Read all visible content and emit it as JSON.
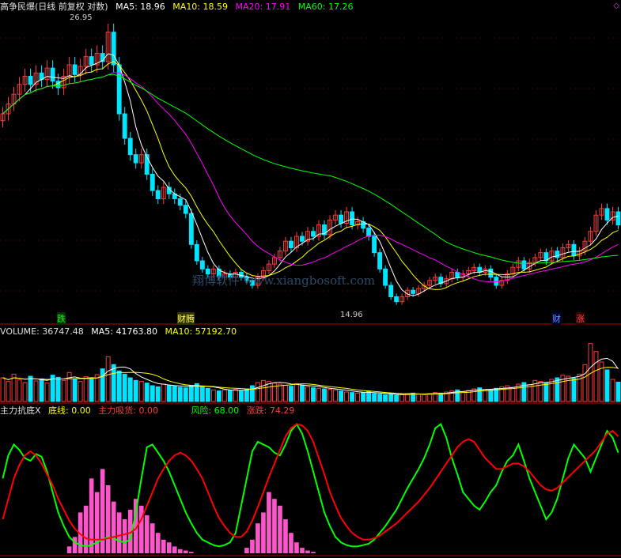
{
  "header_main": {
    "title": "高争民爆(日线 前复权 对数)",
    "ma5": "MA5: 18.96",
    "ma10": "MA10: 18.59",
    "ma20": "MA20: 17.91",
    "ma60": "MA60: 17.26"
  },
  "header_volume": {
    "volume": "VOLUME: 36747.48",
    "ma5": "MA5: 41763.80",
    "ma10": "MA10: 57192.70"
  },
  "header_indicator": {
    "name": "主力抗底X",
    "bottom_line": "底线: 0.00",
    "main_buy": "主力吸货: 0.00",
    "risk": "风险: 68.00",
    "rise_fall": "涨跌: 74.29"
  },
  "annotations": {
    "high_price": "26.95",
    "low_price": "14.96",
    "tag_die": "跌",
    "tag_yuan": "财腾",
    "tag_cai": "财",
    "tag_zhang": "涨",
    "corner": "◇"
  },
  "watermark": "翔博软件 www.xiangbosoft.com",
  "colors": {
    "up": "#ff3a3a",
    "down": "#00e5ff",
    "ma5": "#ffffff",
    "ma10": "#ffff00",
    "ma20": "#ff00ff",
    "ma60": "#00ff00",
    "risk": "#00ff00",
    "rise": "#ff0000",
    "bars": "#ff55cc",
    "axis": "#b00000"
  },
  "chart_data": {
    "type": "candlestick",
    "closes": [
      21.0,
      21.6,
      22.2,
      22.8,
      23.3,
      22.8,
      23.5,
      23.1,
      23.8,
      23.0,
      22.6,
      23.3,
      24.0,
      23.4,
      23.9,
      24.5,
      24.0,
      24.7,
      24.2,
      26.0,
      24.0,
      21.0,
      19.5,
      18.5,
      18.0,
      18.5,
      17.3,
      16.3,
      15.8,
      16.5,
      16.1,
      15.8,
      15.4,
      14.9,
      13.0,
      12.0,
      11.5,
      11.2,
      11.5,
      11.0,
      11.2,
      11.0,
      11.3,
      11.0,
      10.8,
      10.5,
      11.0,
      11.4,
      11.8,
      12.2,
      12.6,
      13.2,
      12.8,
      13.5,
      13.2,
      13.8,
      13.5,
      14.2,
      13.6,
      14.5,
      14.8,
      14.3,
      15.0,
      14.2,
      14.4,
      14.0,
      13.5,
      12.5,
      11.5,
      10.5,
      9.8,
      9.5,
      9.8,
      10.2,
      10.0,
      10.3,
      10.5,
      10.8,
      11.0,
      10.6,
      10.9,
      11.3,
      11.0,
      11.2,
      11.4,
      11.6,
      11.3,
      11.5,
      11.0,
      10.5,
      10.8,
      11.2,
      11.6,
      12.0,
      11.5,
      11.9,
      12.2,
      12.5,
      12.0,
      12.6,
      12.2,
      12.8,
      13.0,
      12.3,
      12.6,
      13.2,
      13.8,
      14.8,
      15.2,
      14.5,
      15.0,
      14.2
    ],
    "volume": [
      45000,
      38000,
      52000,
      41000,
      36000,
      48000,
      39000,
      43000,
      35000,
      50000,
      46000,
      40000,
      55000,
      42000,
      38000,
      47000,
      44000,
      51000,
      62000,
      85000,
      70000,
      58000,
      52000,
      45000,
      40000,
      38000,
      35000,
      30000,
      28000,
      33000,
      31000,
      29000,
      27000,
      26000,
      30000,
      34000,
      28000,
      25000,
      22000,
      20000,
      22000,
      21000,
      23000,
      20000,
      24000,
      30000,
      36000,
      40000,
      38000,
      35000,
      33000,
      31000,
      29000,
      34000,
      30000,
      28000,
      26000,
      25000,
      24000,
      23000,
      22000,
      20000,
      18000,
      17000,
      16000,
      17000,
      19000,
      15000,
      14000,
      13000,
      14000,
      12000,
      13000,
      15000,
      16000,
      14000,
      13000,
      15000,
      17000,
      16000,
      18000,
      20000,
      22000,
      19000,
      21000,
      24000,
      26000,
      23000,
      22000,
      25000,
      28000,
      30000,
      27000,
      33000,
      36000,
      32000,
      40000,
      38000,
      35000,
      42000,
      45000,
      50000,
      48000,
      44000,
      52000,
      70000,
      110000,
      95000,
      75000,
      60000,
      42000,
      36747
    ],
    "risk": [
      55,
      72,
      80,
      76,
      70,
      68,
      73,
      71,
      60,
      45,
      30,
      20,
      12,
      8,
      6,
      5,
      6,
      8,
      10,
      12,
      11,
      9,
      8,
      10,
      30,
      55,
      78,
      80,
      74,
      68,
      60,
      50,
      40,
      30,
      22,
      15,
      10,
      8,
      6,
      5,
      6,
      8,
      15,
      35,
      55,
      75,
      82,
      80,
      78,
      74,
      72,
      80,
      90,
      95,
      88,
      75,
      60,
      45,
      30,
      20,
      12,
      8,
      6,
      5,
      5,
      6,
      7,
      10,
      15,
      20,
      26,
      32,
      40,
      48,
      55,
      62,
      70,
      80,
      92,
      95,
      85,
      70,
      58,
      45,
      40,
      35,
      32,
      38,
      45,
      50,
      60,
      68,
      72,
      80,
      68,
      55,
      45,
      35,
      25,
      30,
      40,
      55,
      70,
      80,
      75,
      70,
      60,
      70,
      80,
      90,
      85,
      74
    ],
    "rise": [
      25,
      40,
      55,
      65,
      72,
      75,
      72,
      66,
      58,
      50,
      40,
      32,
      24,
      18,
      14,
      11,
      10,
      10,
      10,
      11,
      12,
      13,
      14,
      15,
      18,
      25,
      35,
      45,
      55,
      62,
      68,
      72,
      74,
      72,
      68,
      62,
      55,
      45,
      35,
      26,
      20,
      15,
      12,
      12,
      16,
      24,
      34,
      45,
      56,
      66,
      76,
      86,
      92,
      95,
      94,
      90,
      82,
      70,
      58,
      45,
      35,
      26,
      20,
      15,
      12,
      10,
      10,
      11,
      13,
      16,
      19,
      22,
      26,
      30,
      34,
      38,
      43,
      48,
      54,
      60,
      66,
      72,
      78,
      82,
      84,
      82,
      76,
      70,
      66,
      62,
      62,
      64,
      66,
      66,
      64,
      60,
      55,
      50,
      47,
      46,
      48,
      52,
      56,
      60,
      64,
      68,
      72,
      76,
      82,
      88,
      90,
      86
    ],
    "buy_bars": [
      0,
      0,
      0,
      0,
      0,
      0,
      0,
      0,
      0,
      0,
      0,
      0,
      5,
      12,
      30,
      35,
      55,
      45,
      62,
      50,
      38,
      30,
      25,
      32,
      40,
      35,
      28,
      22,
      15,
      10,
      8,
      5,
      3,
      2,
      1,
      0,
      0,
      0,
      0,
      0,
      0,
      0,
      0,
      0,
      4,
      10,
      22,
      30,
      45,
      40,
      35,
      25,
      15,
      8,
      4,
      2,
      1,
      0,
      0,
      0,
      0,
      0,
      0,
      0,
      0,
      0,
      0,
      0,
      0,
      0,
      0,
      0,
      0,
      0,
      0,
      0,
      0,
      0,
      0,
      0,
      0,
      0,
      0,
      0,
      0,
      0,
      0,
      0,
      0,
      0,
      0,
      0,
      0,
      0,
      0,
      0,
      0,
      0,
      0,
      0,
      0,
      0,
      0,
      0,
      0,
      0,
      0,
      0,
      0,
      0,
      0,
      0
    ]
  }
}
